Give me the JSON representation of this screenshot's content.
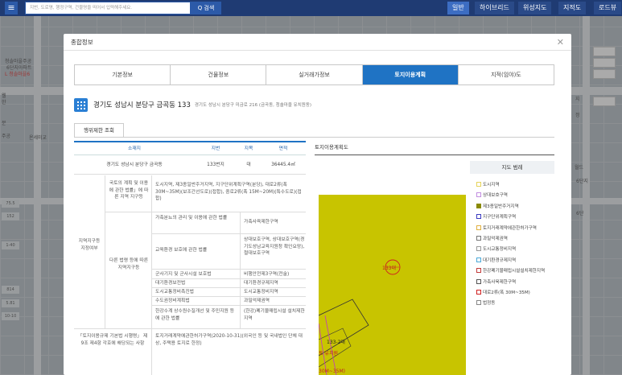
{
  "topbar": {
    "menu_icon": "menu-icon",
    "search_placeholder": "지번, 도로명, 행정구역, 건물명을 띄어서 입력해주세요.",
    "search_label": "Q 검색",
    "map_types": [
      "일반",
      "하이브리드",
      "위성지도",
      "지적도",
      "로드뷰"
    ],
    "active_map_type": "일반"
  },
  "map": {
    "labels": [
      "청솔마을주공",
      "6단지아파트",
      "L 청솔마을6",
      "온세미교",
      "웰",
      "한",
      "분",
      "주공",
      "정",
      "지",
      "월드",
      "6단지",
      "6단"
    ],
    "left_tags": [
      "75.5",
      "152",
      "814",
      "1-40",
      "10-10",
      "5.81"
    ]
  },
  "modal": {
    "title": "종합정보",
    "close_icon": "close-icon",
    "tabs": [
      "기본정보",
      "건물정보",
      "실거래가정보",
      "토지이용계획",
      "지적(임야)도"
    ],
    "active_tab": "토지이용계획",
    "address_main": "경기도 성남시 분당구 금곡동 133",
    "address_sub": "경기도 성남시 분당구 미금로 216 (금곡동, 청솔마을 유치원동)",
    "subtab": "행위제한 조회",
    "table": {
      "headers": [
        "소재지",
        "지번",
        "지목",
        "면적"
      ],
      "row": [
        "경기도 성남시 분당구 금곡동",
        "133번지",
        "대",
        "36445.4㎡"
      ],
      "section_label": "지역지구등 지정여부",
      "national_label": "국토의 계획 및 이용에 관한 법률」에 따른 지역 지구등",
      "national_value": "도시지역, 제3종일반주거지역, 지구단위계획구역(분당), 대로2류(폭 30M~35M)(보조간선도로)(접합), 중로2류(폭 15M~20M)(특수도로)(접합)",
      "other_label": "다른 법령 등에 따른 지역지구등",
      "other_rows": [
        [
          "가축분뇨의 관리 및 이용에 관한 법률",
          "가축사육제한구역"
        ],
        [
          "교육환경 보호에 관한 법률",
          "상대보호구역, 상대보호구역(경기도성남교육지원청 확인요망), 절대보호구역"
        ],
        [
          "군사기지 및 군사시설 보호법",
          "비행안전제3구역(전술)"
        ],
        [
          "대기환경보전법",
          "대기환경규제지역"
        ],
        [
          "도시교통정비촉진법",
          "도시교통정비지역"
        ],
        [
          "수도권정비계획법",
          "과밀억제권역"
        ],
        [
          "한강수계 상수원수질개선 및 주민지원 등에 관한 법률",
          "(한강)폐기물매립시설 설치제한지역"
        ]
      ],
      "bottom_label": "「토지이용규제 기본법 시행령」 제9조 제4항 각호에 해당되는 사항",
      "bottom_value": "토지거래계약에관한허가구역(2020-10-31)(외국인 등 및 국내법인 단체 대상, 주택용 토지로 한정)"
    },
    "right_panel": {
      "title": "토지이용계획도",
      "legend_title": "지도 범례",
      "map_labels": [
        "133대",
        "133-2대",
        "토 유치원",
        "30M~35M)"
      ],
      "legend": [
        {
          "label": "도시지역",
          "color": "#e6d35a"
        },
        {
          "label": "상대보호구역",
          "color": "#c28de0"
        },
        {
          "label": "제3종일반주거지역",
          "color": "#8a8a00"
        },
        {
          "label": "지구단위계획구역",
          "color": "#3a3ac0"
        },
        {
          "label": "토지거래계약에관한허가구역",
          "color": "#e0b040"
        },
        {
          "label": "과밀억제권역",
          "color": "#777777"
        },
        {
          "label": "도시교통정비지역",
          "color": "#999999"
        },
        {
          "label": "대기환경규제지역",
          "color": "#4aa8d8"
        },
        {
          "label": "한강폐기물매립시설설치제한지역",
          "color": "#c23a3a"
        },
        {
          "label": "가축사육제한구역",
          "color": "#555555"
        },
        {
          "label": "대로2류(폭 30M~35M)",
          "color": "#d02020"
        },
        {
          "label": "법정동",
          "color": "#888888"
        }
      ]
    }
  }
}
